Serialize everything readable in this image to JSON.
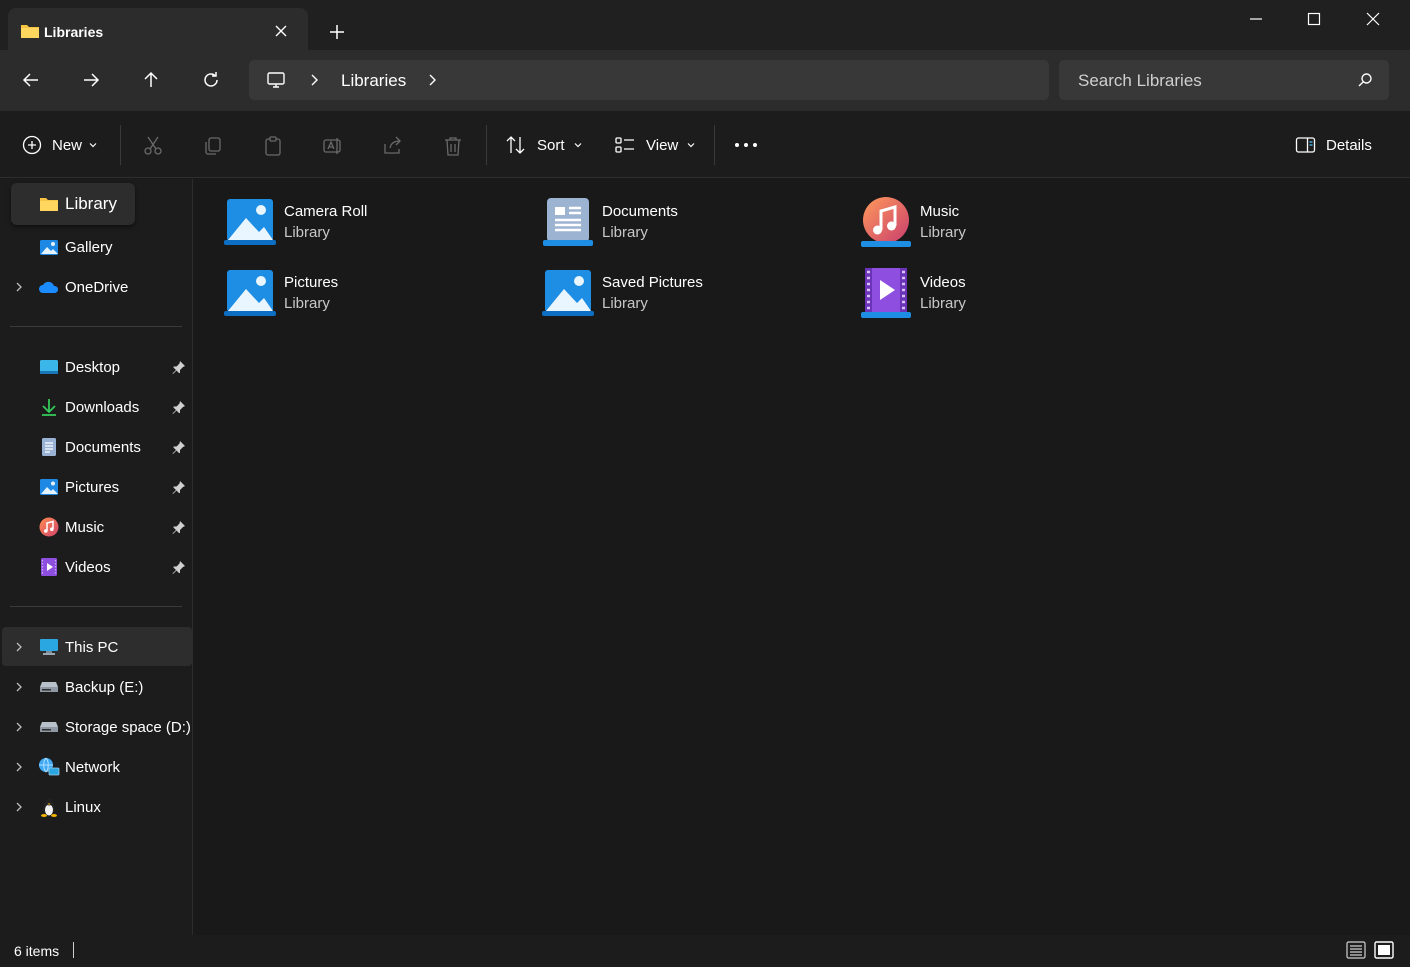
{
  "tab": {
    "title": "Libraries"
  },
  "address": {
    "segment": "Libraries"
  },
  "search": {
    "placeholder": "Search Libraries"
  },
  "toolbar": {
    "new_label": "New",
    "sort_label": "Sort",
    "view_label": "View",
    "details_label": "Details"
  },
  "sidebar": {
    "top": [
      {
        "label": "Library",
        "icon": "folder-icon",
        "selected": true
      },
      {
        "label": "Gallery",
        "icon": "gallery-icon"
      },
      {
        "label": "OneDrive",
        "icon": "cloud-icon",
        "expandable": true
      }
    ],
    "quick_access": [
      {
        "label": "Desktop",
        "icon": "desktop-icon"
      },
      {
        "label": "Downloads",
        "icon": "download-icon"
      },
      {
        "label": "Documents",
        "icon": "document-icon"
      },
      {
        "label": "Pictures",
        "icon": "picture-icon"
      },
      {
        "label": "Music",
        "icon": "music-icon"
      },
      {
        "label": "Videos",
        "icon": "video-icon"
      }
    ],
    "drives": [
      {
        "label": "This PC",
        "icon": "monitor-icon"
      },
      {
        "label": "Backup (E:)",
        "icon": "drive-icon"
      },
      {
        "label": "Storage space (D:)",
        "icon": "drive-icon"
      },
      {
        "label": "Network",
        "icon": "network-icon"
      },
      {
        "label": "Linux",
        "icon": "linux-icon"
      }
    ]
  },
  "libraries": [
    {
      "name": "Camera Roll",
      "type": "Library",
      "icon": "picture-library-icon"
    },
    {
      "name": "Documents",
      "type": "Library",
      "icon": "document-library-icon"
    },
    {
      "name": "Music",
      "type": "Library",
      "icon": "music-library-icon"
    },
    {
      "name": "Pictures",
      "type": "Library",
      "icon": "picture-library-icon"
    },
    {
      "name": "Saved Pictures",
      "type": "Library",
      "icon": "picture-library-icon"
    },
    {
      "name": "Videos",
      "type": "Library",
      "icon": "video-library-icon"
    }
  ],
  "status": {
    "item_count": "6 items"
  }
}
